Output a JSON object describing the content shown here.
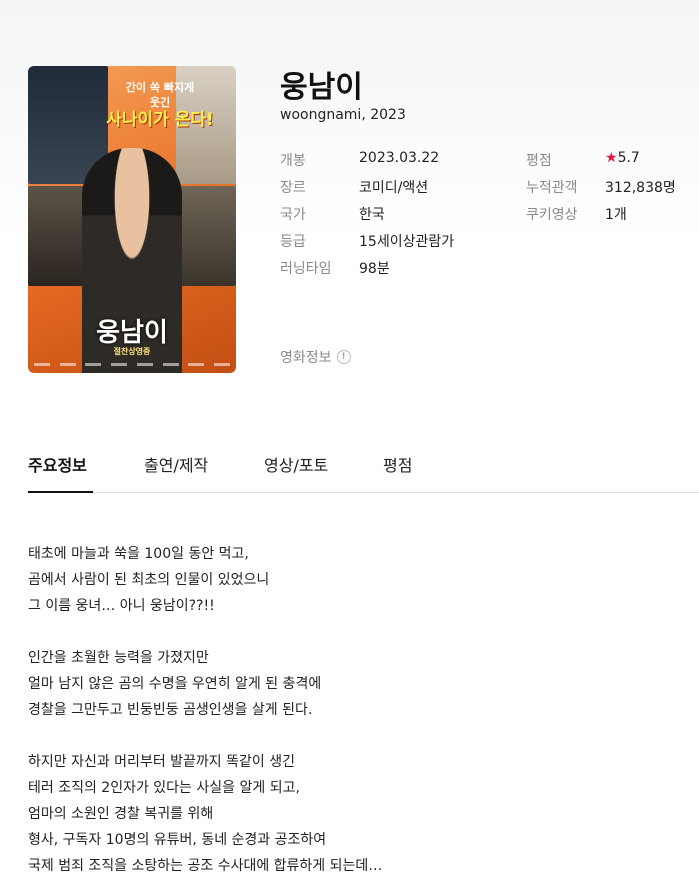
{
  "movie": {
    "title": "웅남이",
    "subtitle": "woongnami, 2023",
    "poster": {
      "tagline_1": "간이 쏙 빠지게",
      "tagline_2": "웃긴",
      "tagline_3": "사나이가 온다!",
      "title_art": "웅남이",
      "subtitle_art": "절찬상영중"
    },
    "info_left": [
      {
        "label": "개봉",
        "value": "2023.03.22"
      },
      {
        "label": "장르",
        "value": "코미디/액션"
      },
      {
        "label": "국가",
        "value": "한국"
      },
      {
        "label": "등급",
        "value": "15세이상관람가"
      },
      {
        "label": "러닝타임",
        "value": "98분"
      }
    ],
    "info_right": [
      {
        "label": "평점",
        "star": "★",
        "value": "5.7"
      },
      {
        "label": "누적관객",
        "value": "312,838명"
      },
      {
        "label": "쿠키영상",
        "value": "1개"
      }
    ],
    "more_info_label": "영화정보",
    "more_info_icon": "!"
  },
  "tabs": [
    {
      "label": "주요정보",
      "active": true
    },
    {
      "label": "출연/제작",
      "active": false
    },
    {
      "label": "영상/포토",
      "active": false
    },
    {
      "label": "평점",
      "active": false
    }
  ],
  "synopsis": {
    "paragraph_1": [
      "태초에 마늘과 쑥을 100일 동안 먹고,",
      "곰에서 사람이 된 최초의 인물이 있었으니",
      "그 이름 웅녀… 아니 웅남이??!!"
    ],
    "paragraph_2": [
      "인간을 초월한 능력을 가졌지만",
      "얼마 남지 않은 곰의 수명을 우연히 알게 된 충격에",
      "경찰을 그만두고 빈둥빈둥 곰생인생을 살게 된다."
    ],
    "paragraph_3": [
      "하지만 자신과 머리부터 발끝까지 똑같이 생긴",
      "테러 조직의 2인자가 있다는 사실을 알게 되고,",
      "엄마의 소원인 경찰 복귀를 위해",
      "형사, 구독자 10명의 유튜버, 동네 순경과 공조하여",
      "국제 범죄 조직을 소탕하는 공조 수사대에 합류하게 되는데…"
    ]
  },
  "colors": {
    "star": "#e5193b",
    "label_gray": "#8a8a8a",
    "text": "#222222",
    "tab_underline": "#111111"
  }
}
